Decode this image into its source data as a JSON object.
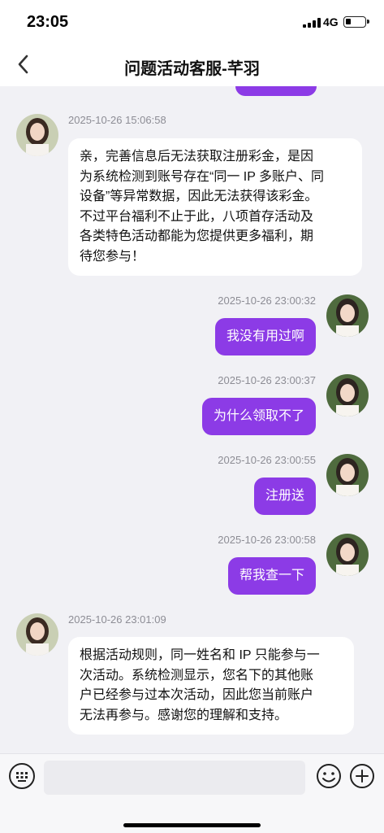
{
  "status_bar": {
    "time": "23:05",
    "network": "4G"
  },
  "nav": {
    "title": "问题活动客服-芊羽"
  },
  "messages": [
    {
      "side": "in",
      "time": "2025-10-26 15:06:58",
      "lines": [
        "亲，完善信息后无法获取注册彩金，是因",
        "为系统检测到账号存在“同一 IP 多账户、同",
        "设备”等异常数据，因此无法获得该彩金。",
        "不过平台福利不止于此，八项首存活动及",
        "各类特色活动都能为您提供更多福利，期",
        "待您参与！"
      ]
    },
    {
      "side": "out",
      "time": "2025-10-26 23:00:32",
      "text": "我没有用过啊"
    },
    {
      "side": "out",
      "time": "2025-10-26 23:00:37",
      "text": "为什么领取不了"
    },
    {
      "side": "out",
      "time": "2025-10-26 23:00:55",
      "text": "注册送"
    },
    {
      "side": "out",
      "time": "2025-10-26 23:00:58",
      "text": "帮我查一下"
    },
    {
      "side": "in",
      "time": "2025-10-26 23:01:09",
      "lines": [
        "根据活动规则，同一姓名和 IP 只能参与一",
        "次活动。系统检测显示，您名下的其他账",
        "户已经参与过本次活动，因此您当前账户",
        "无法再参与。感谢您的理解和支持。"
      ]
    }
  ],
  "input": {
    "value": "",
    "placeholder": ""
  },
  "colors": {
    "accent": "#8c3be6",
    "background": "#f1f1f5",
    "incoming_bubble": "#ffffff"
  },
  "icons": [
    "back-arrow-icon",
    "keyboard-icon",
    "emoji-icon",
    "plus-icon",
    "signal-icon",
    "battery-icon"
  ]
}
